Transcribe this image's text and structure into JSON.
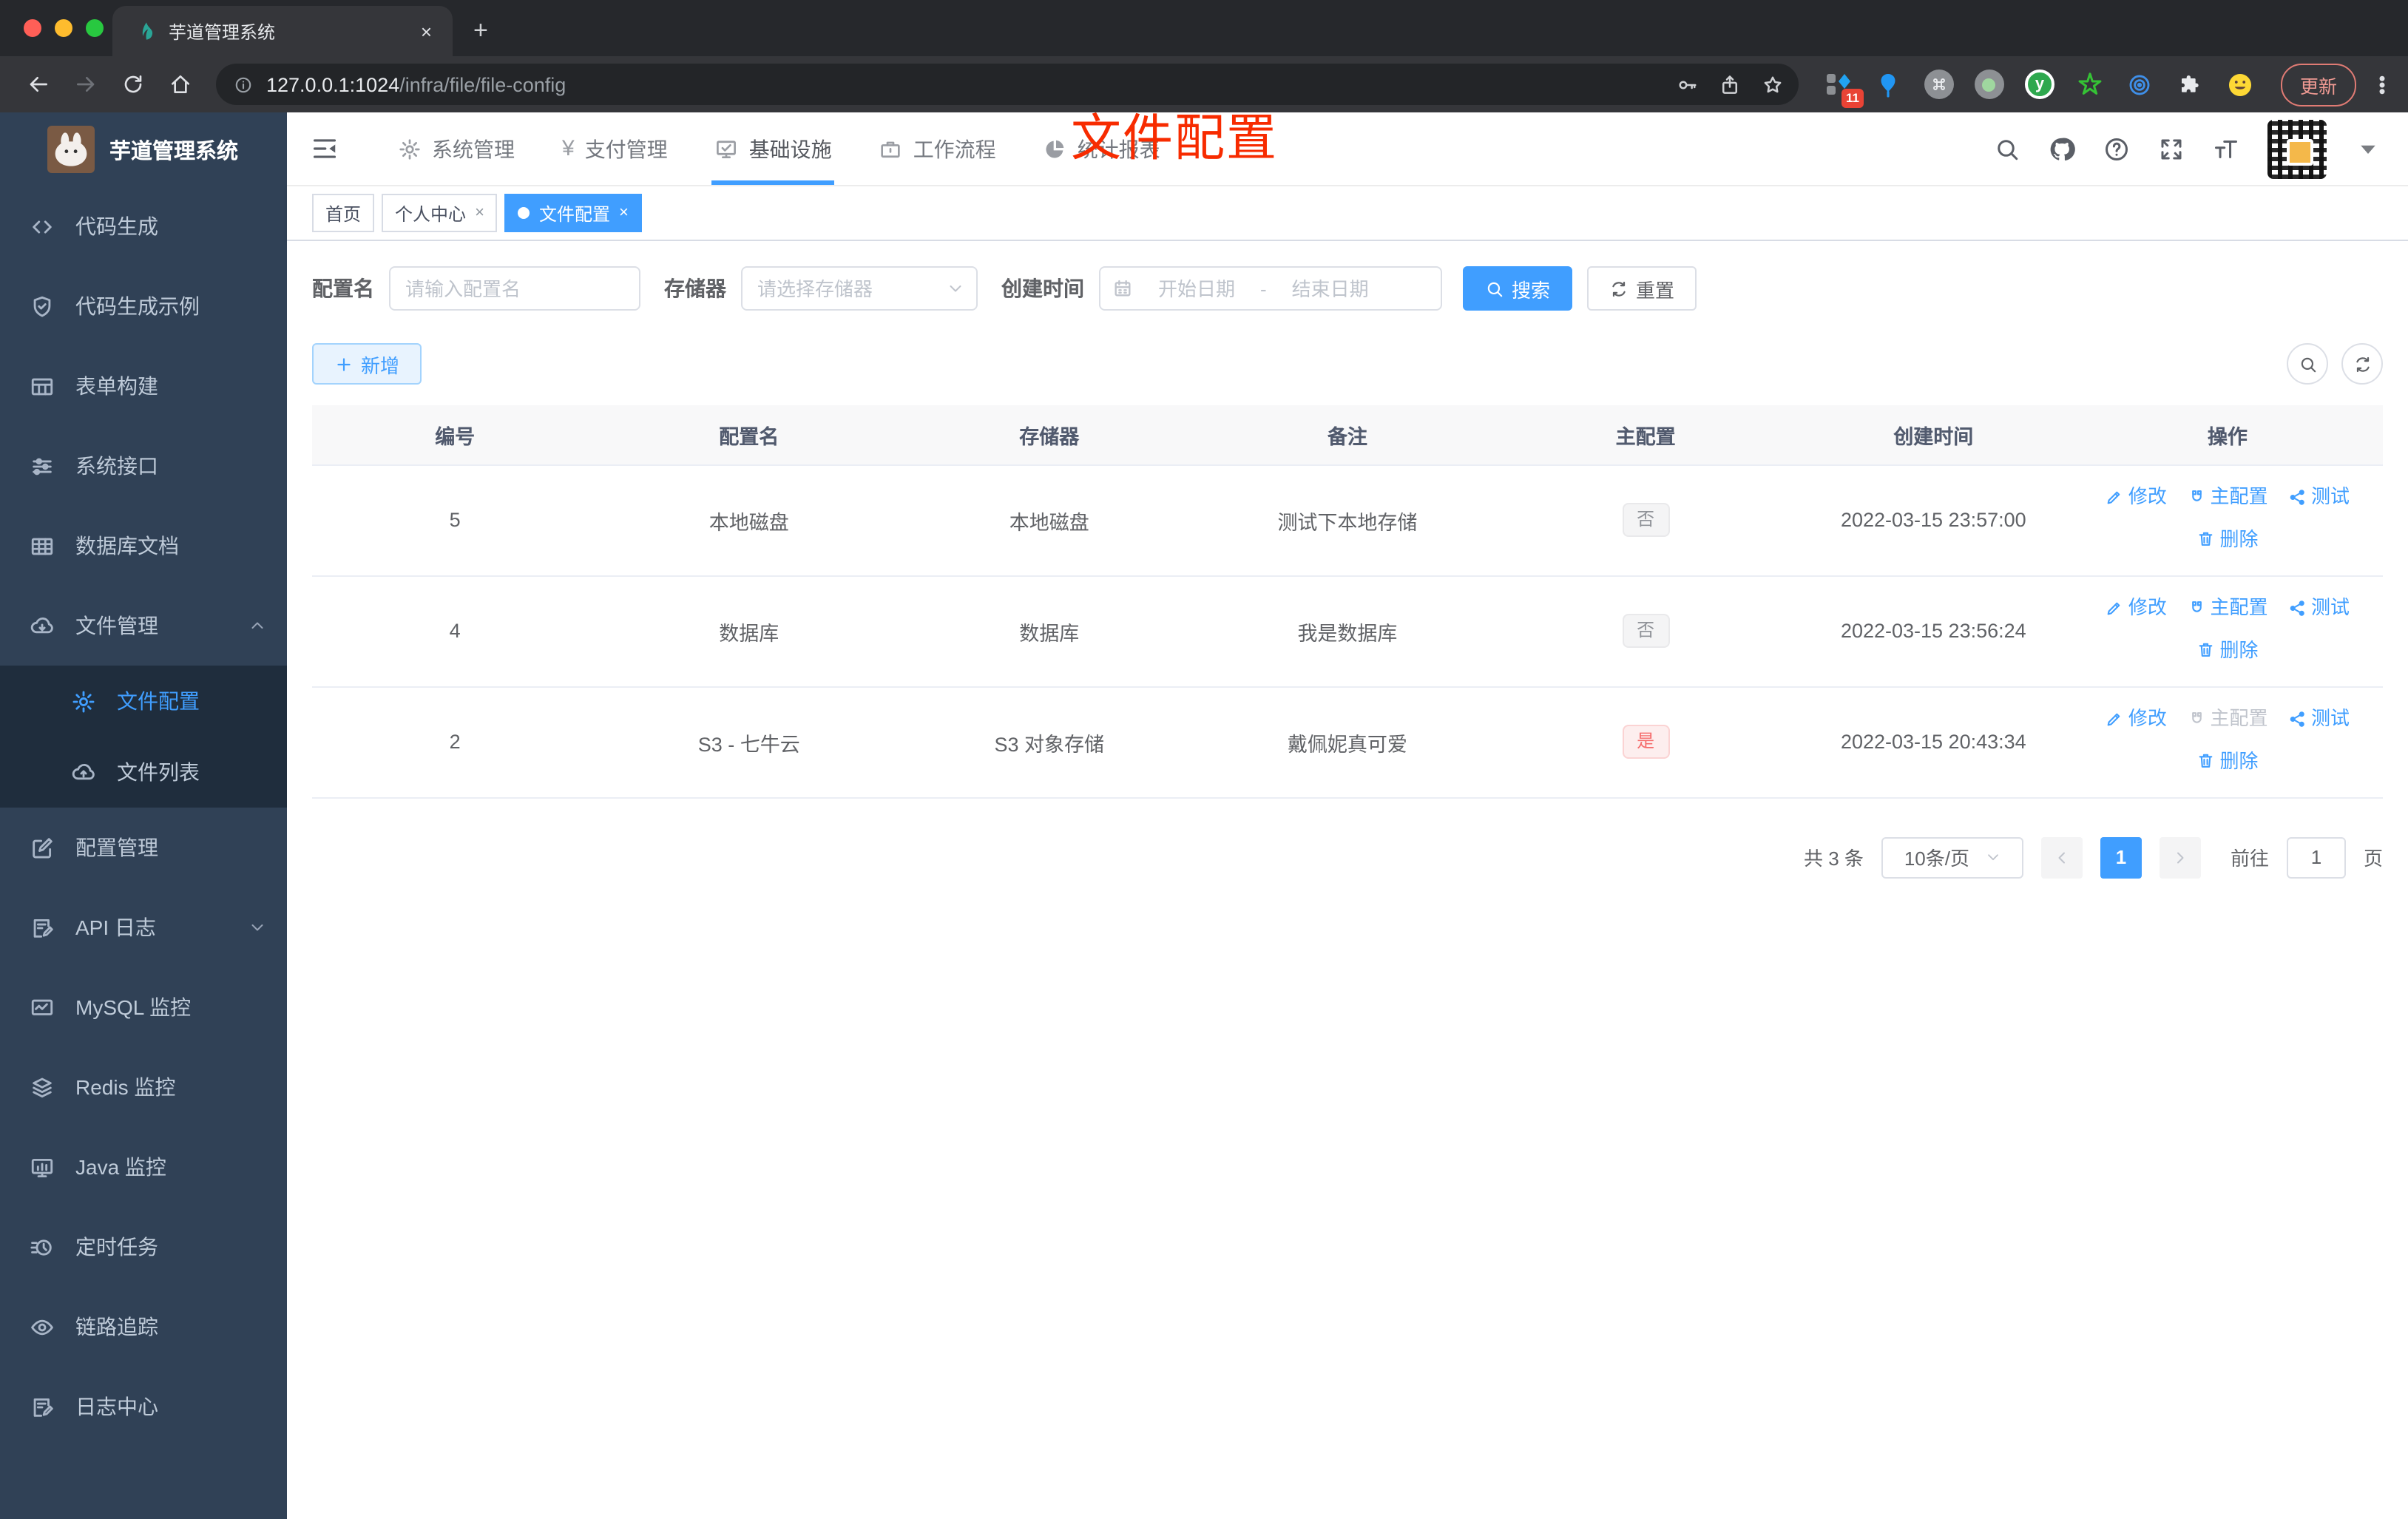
{
  "browser": {
    "tab_title": "芋道管理系统",
    "close_tab": "×",
    "url_host": "127.0.0.1:1024",
    "url_path": "/infra/file/file-config",
    "update_label": "更新",
    "extension_badge": "11",
    "ext_y_label": "y"
  },
  "sidebar": {
    "logo_title": "芋道管理系统",
    "items": [
      {
        "label": "代码生成"
      },
      {
        "label": "代码生成示例"
      },
      {
        "label": "表单构建"
      },
      {
        "label": "系统接口"
      },
      {
        "label": "数据库文档"
      },
      {
        "label": "文件管理"
      },
      {
        "label": "文件配置"
      },
      {
        "label": "文件列表"
      },
      {
        "label": "配置管理"
      },
      {
        "label": "API 日志"
      },
      {
        "label": "MySQL 监控"
      },
      {
        "label": "Redis 监控"
      },
      {
        "label": "Java 监控"
      },
      {
        "label": "定时任务"
      },
      {
        "label": "链路追踪"
      },
      {
        "label": "日志中心"
      }
    ]
  },
  "topnav": {
    "items": [
      {
        "label": "系统管理"
      },
      {
        "label": "支付管理"
      },
      {
        "label": "基础设施"
      },
      {
        "label": "工作流程"
      },
      {
        "label": "统计报表"
      }
    ]
  },
  "tags": {
    "items": [
      {
        "label": "首页"
      },
      {
        "label": "个人中心"
      },
      {
        "label": "文件配置"
      }
    ],
    "close": "×"
  },
  "annotation": {
    "text": "文件配置",
    "color": "#f72b00"
  },
  "filters": {
    "name_label": "配置名",
    "name_placeholder": "请输入配置名",
    "storage_label": "存储器",
    "storage_placeholder": "请选择存储器",
    "date_label": "创建时间",
    "date_start_placeholder": "开始日期",
    "date_separator": "-",
    "date_end_placeholder": "结束日期",
    "search_label": "搜索",
    "reset_label": "重置"
  },
  "toolbar": {
    "add_label": "新增"
  },
  "table": {
    "columns": [
      "编号",
      "配置名",
      "存储器",
      "备注",
      "主配置",
      "创建时间",
      "操作"
    ],
    "action_labels": {
      "edit": "修改",
      "master": "主配置",
      "test": "测试",
      "delete": "删除"
    },
    "rows": [
      {
        "id": "5",
        "name": "本地磁盘",
        "storage": "本地磁盘",
        "remark": "测试下本地存储",
        "primary": "否",
        "created": "2022-03-15 23:57:00"
      },
      {
        "id": "4",
        "name": "数据库",
        "storage": "数据库",
        "remark": "我是数据库",
        "primary": "否",
        "created": "2022-03-15 23:56:24"
      },
      {
        "id": "2",
        "name": "S3 - 七牛云",
        "storage": "S3 对象存储",
        "remark": "戴佩妮真可爱",
        "primary": "是",
        "created": "2022-03-15 20:43:34"
      }
    ]
  },
  "pagination": {
    "total": "共 3 条",
    "page_size": "10条/页",
    "prev": "‹",
    "current": "1",
    "next": "›",
    "goto_label": "前往",
    "goto_value": "1",
    "page_suffix": "页"
  },
  "colors": {
    "accent": "#409eff",
    "sidebar_bg": "#304156",
    "submenu_bg": "#1f2d3d",
    "danger": "#f56c6c",
    "annotation_red": "#f72b00"
  }
}
